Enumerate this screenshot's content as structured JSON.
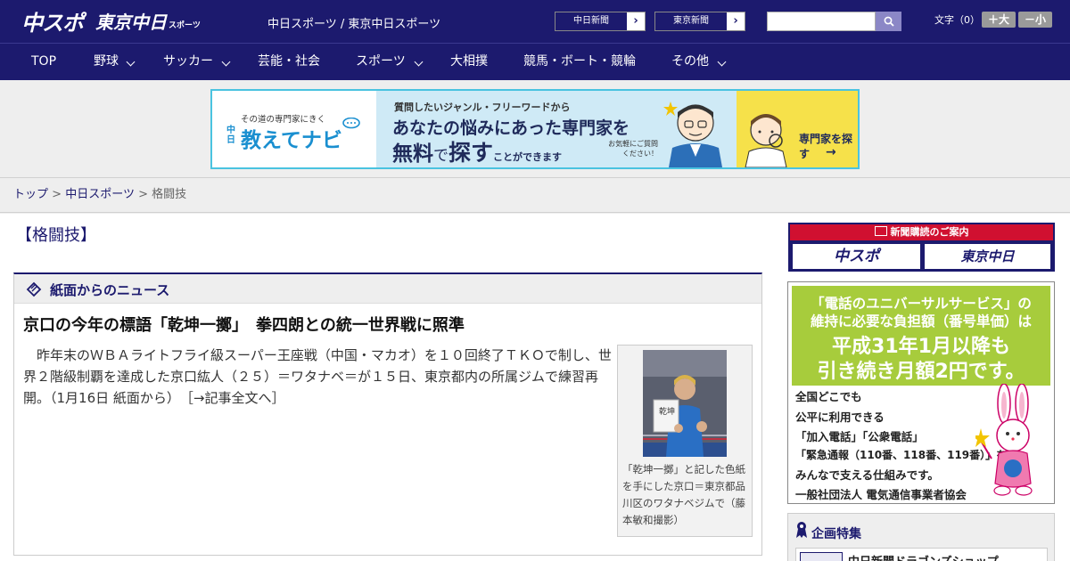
{
  "header": {
    "logo_chuspo": "中スポ",
    "logo_tokyo": "東京中日",
    "logo_sub": "スポーツ",
    "title": "中日スポーツ / 東京中日スポーツ",
    "site_buttons": [
      "中日新聞",
      "東京新聞"
    ],
    "font_label": "文字（0）",
    "font_up": "＋大",
    "font_down": "－小"
  },
  "nav": {
    "items": [
      "TOP",
      "野球",
      "サッカー",
      "芸能・社会",
      "スポーツ",
      "大相撲",
      "競馬・ボート・競輪",
      "その他"
    ]
  },
  "banner": {
    "kicker": "その道の専門家にきく",
    "brand": "教えてナビ",
    "brand_prefix": "中日",
    "line1": "質問したいジャンル・フリーワードから",
    "line2": "あなたの悩みにあった専門家を",
    "line3a": "無料",
    "line3b": "で",
    "line3c": "探す",
    "line3d": "ことができます",
    "note": "お気軽にご質問ください！",
    "cta": "専門家を探す"
  },
  "breadcrumb": {
    "home": "トップ",
    "section": "中日スポーツ",
    "current": "格闘技",
    "sep": ">"
  },
  "main": {
    "category": "【格闘技】",
    "box_label": "紙面からのニュース",
    "article": {
      "title": "京口の今年の標語「乾坤一擲」　拳四朗との統一世界戦に照準",
      "body": "昨年末のＷＢＡライトフライ級スーパー王座戦（中国・マカオ）を１０回終了ＴＫＯで制し、世界２階級制覇を達成した京口紘人（２５）＝ワタナベ＝が１５日、東京都内の所属ジムで練習再開。（1月16日 紙面から）",
      "more": "［→記事全文へ］",
      "caption": "「乾坤一擲」と記した色紙を手にした京口＝東京都品川区のワタナベジムで（藤本敏和撮影）"
    }
  },
  "sidebar": {
    "subscribe_top": "新聞購読のご案内",
    "sub_chuspo": "中スポ",
    "sub_tokyo": "東京中日",
    "ad": {
      "h1": "「電話のユニバーサルサービス」の",
      "h2": "維持に必要な負担額（番号単価）は",
      "h3": "平成31年1月以降も",
      "h4": "引き続き月額2円です。",
      "l1": "全国どこでも",
      "l2": "公平に利用できる",
      "l3": "「加入電話」「公衆電話」",
      "l4": "「緊急通報（110番、118番、119番）」を",
      "l5": "みんなで支える仕組みです。",
      "l6": "一般社団法人 電気通信事業者協会"
    },
    "feature_label": "企画特集",
    "feature_item": "中日新聞ドラゴンズショップ"
  }
}
